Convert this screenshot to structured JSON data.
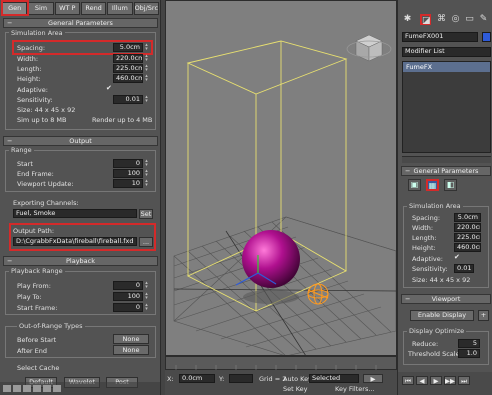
{
  "left_panel": {
    "tabs": [
      "Gen",
      "Sim",
      "WT P",
      "Rend",
      "Illum",
      "Obj/Src"
    ],
    "general_parameters": {
      "title": "General Parameters",
      "simulation_area": {
        "label": "Simulation Area",
        "spacing": {
          "label": "Spacing:",
          "value": "5.0cm"
        },
        "width": {
          "label": "Width:",
          "value": "220.0cm"
        },
        "length": {
          "label": "Length:",
          "value": "225.0cm"
        },
        "height": {
          "label": "Height:",
          "value": "460.0cm"
        },
        "adaptive": {
          "label": "Adaptive:",
          "checked": "✔"
        },
        "sensitivity": {
          "label": "Sensitivity:",
          "value": "0.01"
        },
        "size": "Size:  44 x 45 x 92",
        "sim_up_to": "Sim up to 8 MB",
        "render_up_to": "Render up to 4 MB"
      }
    },
    "output": {
      "title": "Output",
      "range": {
        "label": "Range",
        "start": {
          "label": "Start",
          "value": "0"
        },
        "end_frame": {
          "label": "End Frame:",
          "value": "100"
        },
        "viewport_update": {
          "label": "Viewport Update:",
          "value": "10"
        }
      },
      "exporting_channels": {
        "label": "Exporting Channels:",
        "value": "Fuel, Smoke",
        "set_label": "Set"
      },
      "output_path": {
        "label": "Output Path:",
        "value": "D:\\CgrabbFxData\\fireball\\fireball.fxd",
        "browse_label": "..."
      }
    },
    "playback": {
      "title": "Playback",
      "playback_range": {
        "label": "Playback Range",
        "play_from": {
          "label": "Play From:",
          "value": "0"
        },
        "play_to": {
          "label": "Play To:",
          "value": "100"
        },
        "start_frame": {
          "label": "Start Frame:",
          "value": "0"
        }
      },
      "out_of_range": {
        "label": "Out-of-Range Types",
        "before_start": {
          "label": "Before Start",
          "value": "None"
        },
        "after_end": {
          "label": "After End",
          "value": "None"
        }
      },
      "select_cache": {
        "label": "Select Cache",
        "default": "Default",
        "wavelet": "Wavelet",
        "post": "Post"
      }
    }
  },
  "timeline": {
    "frame": "0.0cm",
    "grid": "Grid = 2",
    "auto_key": "Auto Key",
    "selected": "Selected",
    "set_key": "Set Key",
    "key_filters": "Key Filters..."
  },
  "right_panel": {
    "object_name": "FumeFX001",
    "modifier_list": "Modifier List",
    "stack_item": "FumeFX",
    "general_parameters": {
      "title": "General Parameters",
      "simulation_area": {
        "label": "Simulation Area",
        "spacing": {
          "label": "Spacing:",
          "value": "5.0cm"
        },
        "width": {
          "label": "Width:",
          "value": "220.0cm"
        },
        "length": {
          "label": "Length:",
          "value": "225.0cm"
        },
        "height": {
          "label": "Height:",
          "value": "460.0cm"
        },
        "adaptive": {
          "label": "Adaptive:",
          "checked": "✔"
        },
        "sensitivity": {
          "label": "Sensitivity:",
          "value": "0.01"
        },
        "size": "Size:  44 x 45 x 92"
      }
    },
    "viewport": {
      "title": "Viewport",
      "enable_display": "Enable Display",
      "display_optimize": "Display Optimize",
      "reduce": {
        "label": "Reduce:",
        "value": "5"
      },
      "threshold_scale": {
        "label": "Threshold Scale:",
        "value": "1.0"
      }
    }
  },
  "colors": {
    "highlight_box": "#d42a2a",
    "object_color": "#2e5bd9",
    "gizmo_yellow": "#e8e070",
    "sphere_magenta": "#b0108f"
  }
}
